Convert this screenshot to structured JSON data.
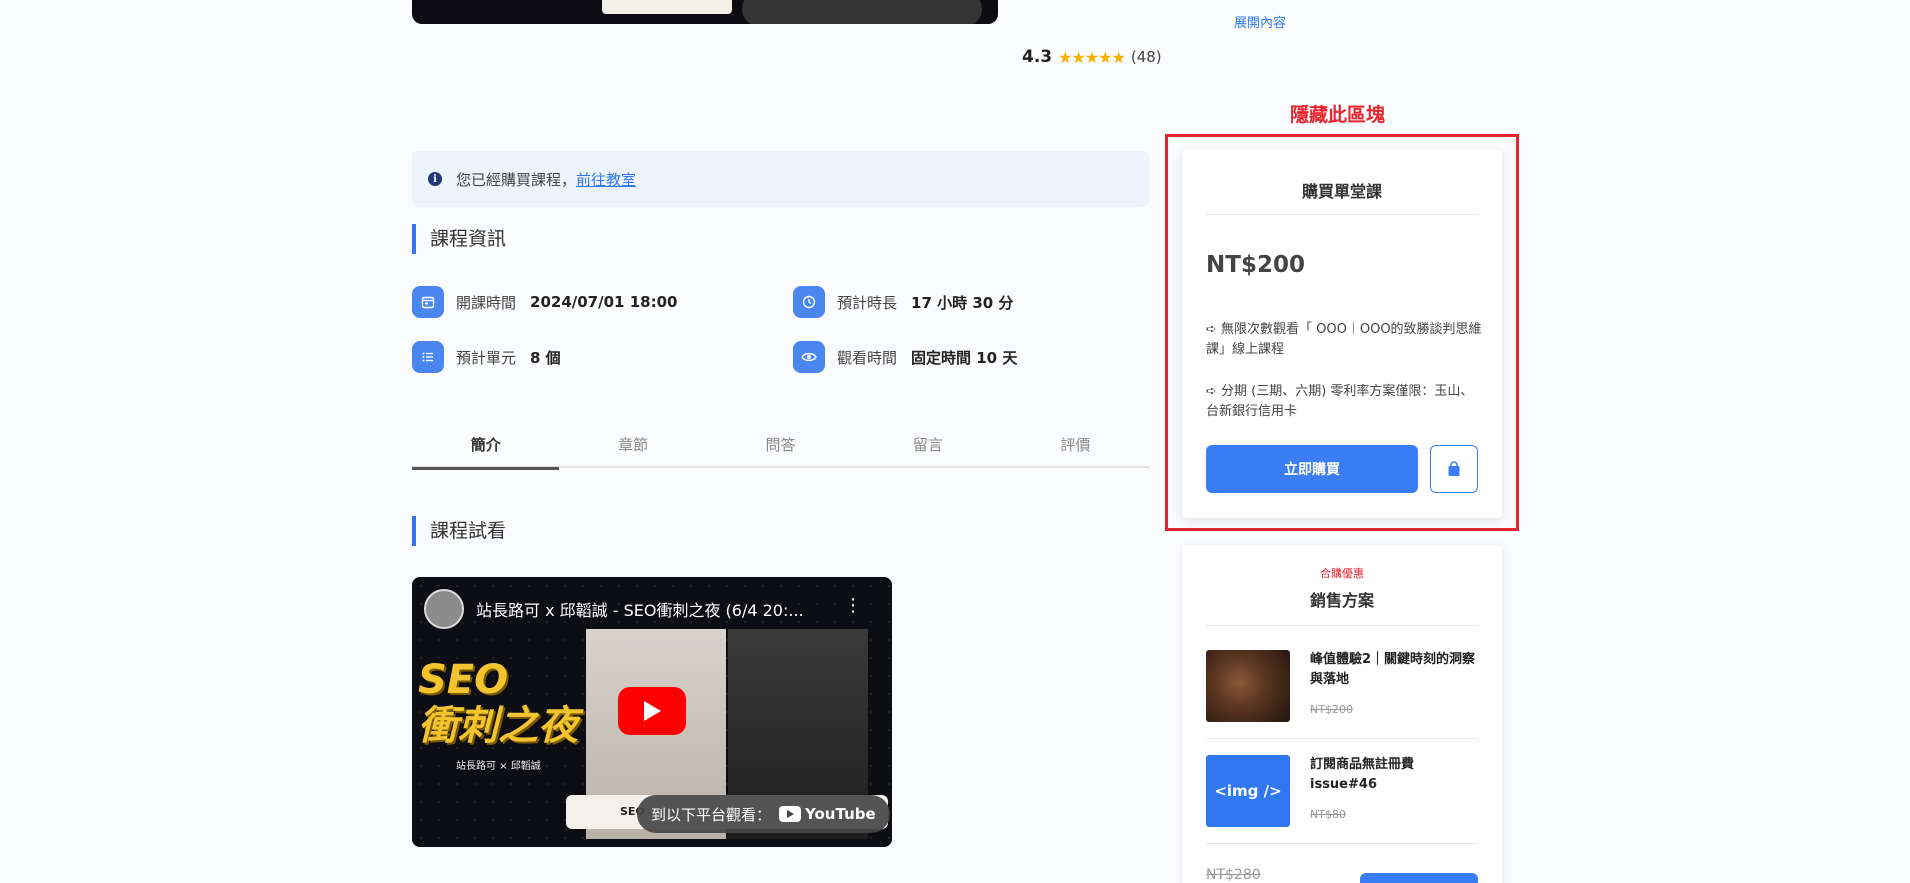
{
  "top": {
    "expand_link": "展開內容",
    "rating_score": "4.3",
    "rating_count": "(48)",
    "rating_stars": 4.3
  },
  "annotation": {
    "hide_label": "隱藏此區塊"
  },
  "buy_card": {
    "title": "購買單堂課",
    "price": "NT$200",
    "feature_1": "➪ 無限次數觀看「 OOO｜OOO的致勝談判思維課」線上課程",
    "feature_2": "➪ 分期 (三期、六期) 零利率方案僅限：玉山、台新銀行信用卡",
    "buy_button": "立即購買",
    "cart_icon": "shopping-bag-icon"
  },
  "plan_card": {
    "badge": "合購優惠",
    "title": "銷售方案",
    "items": [
      {
        "name": "峰值體驗2｜關鍵時刻的洞察與落地",
        "old_price": "NT$200"
      },
      {
        "name": "訂閱商品無註冊費 issue#46",
        "old_price": "NT$80",
        "thumb_text": "<img />"
      }
    ],
    "total": "NT$280"
  },
  "notice": {
    "text": "您已經購買課程，",
    "link": "前往教室"
  },
  "course_info": {
    "title": "課程資訊",
    "start_label": "開課時間",
    "start_value": "2024/07/01 18:00",
    "duration_label": "預計時長",
    "duration_value": "17 小時 30 分",
    "units_label": "預計單元",
    "units_value": "8 個",
    "watch_label": "觀看時間",
    "watch_value": "固定時間 10 天"
  },
  "tabs": [
    "簡介",
    "章節",
    "問答",
    "留言",
    "評價"
  ],
  "preview": {
    "title": "課程試看",
    "video_title": "站長路可 x 邱韜誠 - SEO衝刺之夜 (6/4 20:...",
    "seo_line1": "SEO",
    "seo_line2": "衝刺之夜",
    "seo_sub": "站長路可 × 邱韜誠",
    "caption_left": "SEO",
    "watch_on": "到以下平台觀看：",
    "youtube": "YouTube"
  },
  "top_video": {
    "watch_on": "到以下平台觀看：",
    "youtube": "YouTube"
  },
  "colors": {
    "accent": "#3a7df5",
    "highlight_red": "#e8242e",
    "star": "#f5b301"
  }
}
